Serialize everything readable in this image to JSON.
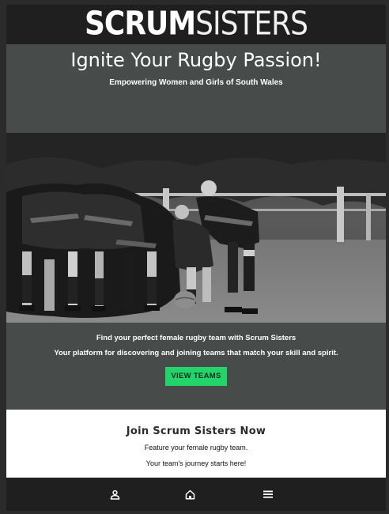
{
  "header": {
    "logo_part1": "SCRUM",
    "logo_part2": "SISTERS"
  },
  "hero": {
    "title": "Ignite Your Rugby Passion!",
    "subtitle": "Empowering Women and Girls of South Wales"
  },
  "cta": {
    "line1": "Find your perfect female rugby team with Scrum Sisters",
    "line2": "Your platform for discovering and joining teams that match your skill and spirit.",
    "button_label": "VIEW TEAMS"
  },
  "join": {
    "title": "Join Scrum Sisters Now",
    "line1": "Feature your female rugby team.",
    "line2": "Your team's journey starts here!"
  },
  "bottom_nav": {
    "icons": [
      "user-icon",
      "home-icon",
      "menu-icon"
    ]
  },
  "colors": {
    "bar_bg": "#1f1f1f",
    "section_bg": "#474b4a",
    "accent_green": "#22d46a"
  }
}
